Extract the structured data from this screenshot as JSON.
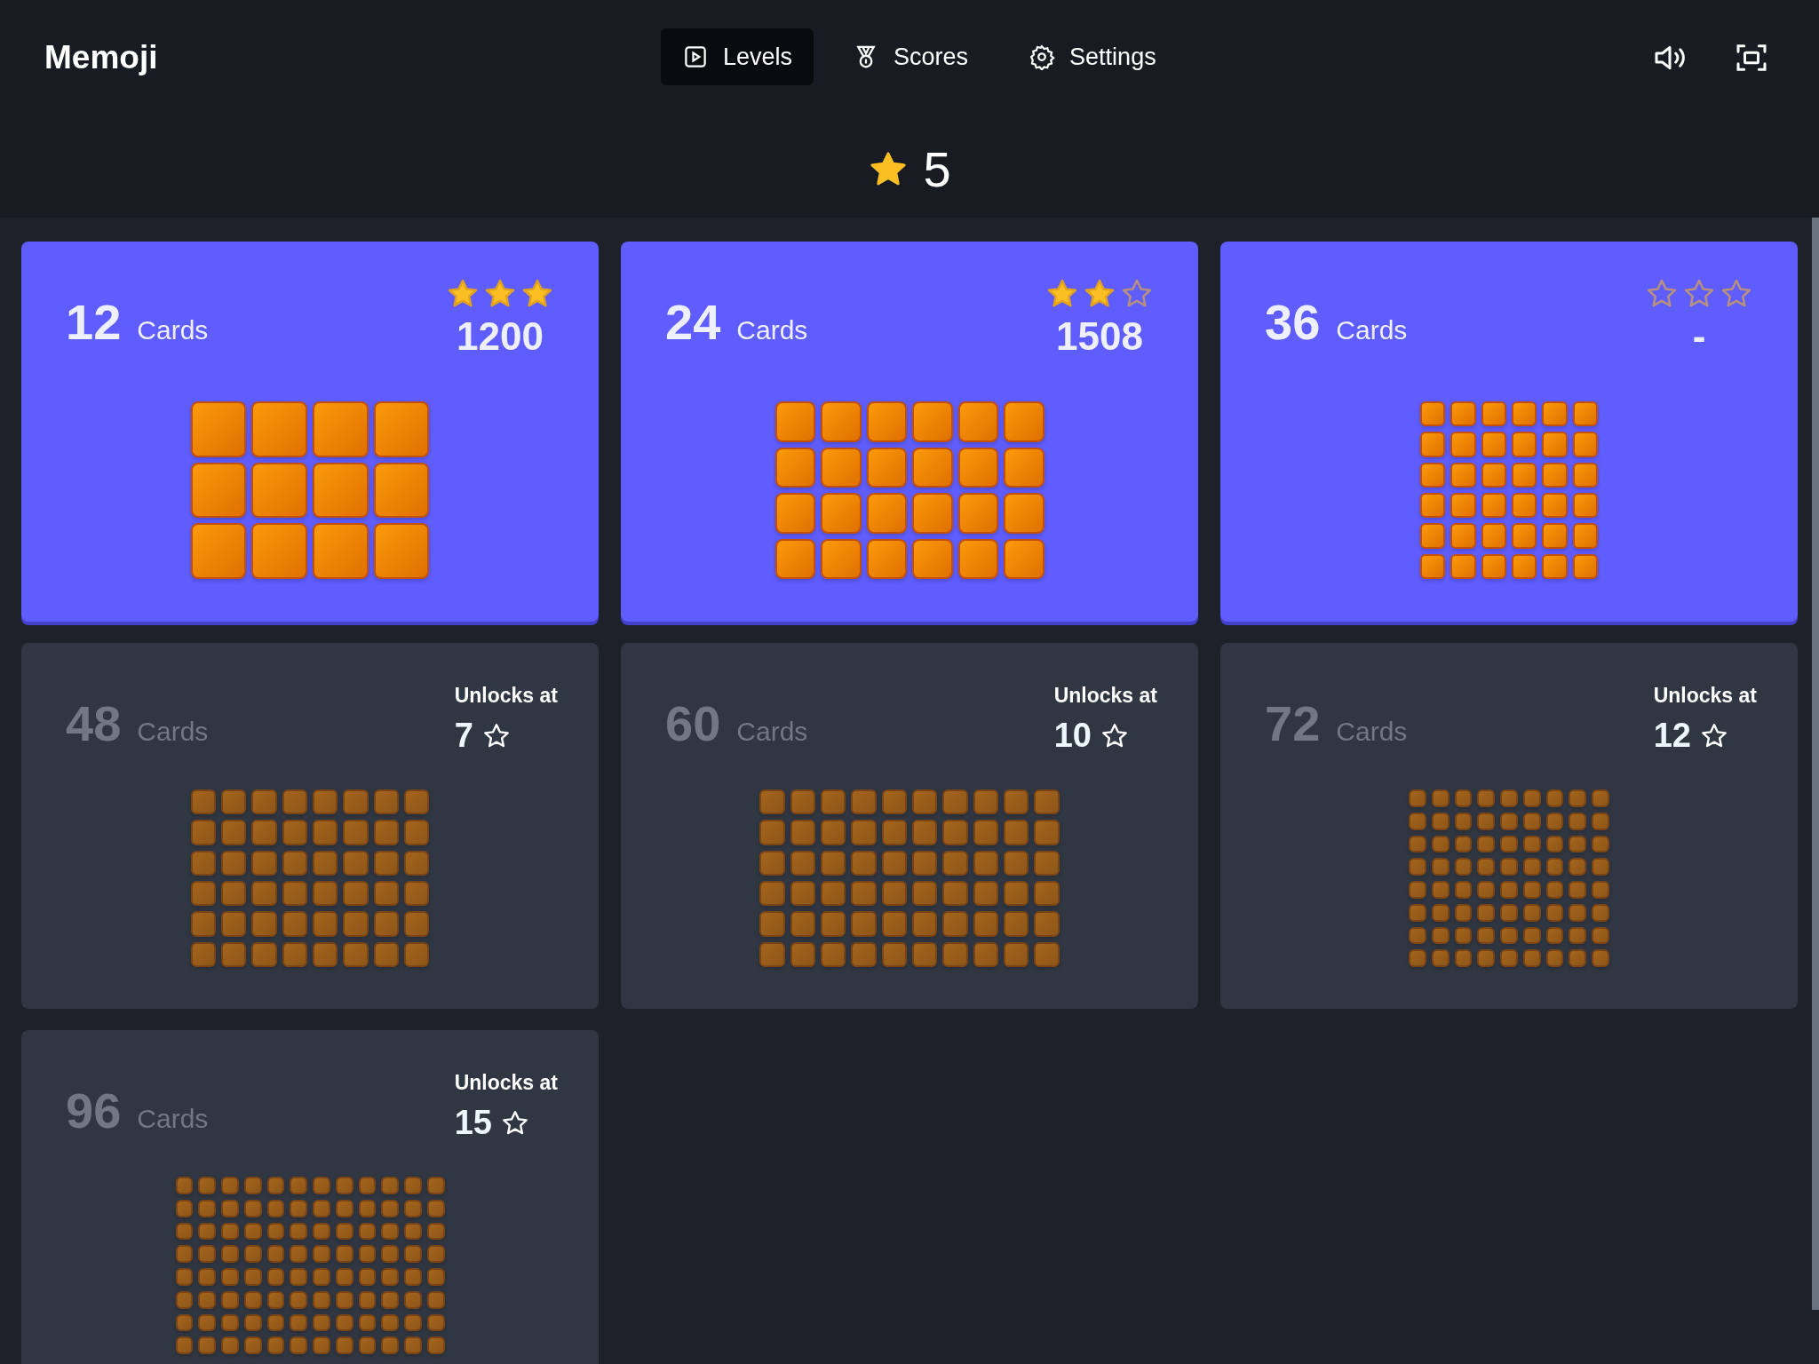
{
  "app_title": "Memoji",
  "nav": [
    {
      "label": "Levels",
      "kind": "play",
      "selected": true
    },
    {
      "label": "Scores",
      "kind": "medal",
      "selected": false
    },
    {
      "label": "Settings",
      "kind": "gear",
      "selected": false
    }
  ],
  "total_stars": "5",
  "levels": [
    {
      "count": "12",
      "unit": "Cards",
      "locked": false,
      "stars": 3,
      "score": "1200"
    },
    {
      "count": "24",
      "unit": "Cards",
      "locked": false,
      "stars": 2,
      "score": "1508"
    },
    {
      "count": "36",
      "unit": "Cards",
      "locked": false,
      "stars": 0,
      "score": "-"
    },
    {
      "count": "48",
      "unit": "Cards",
      "locked": true,
      "unlock_label": "Unlocks at",
      "unlock_stars": "7"
    },
    {
      "count": "60",
      "unit": "Cards",
      "locked": true,
      "unlock_label": "Unlocks at",
      "unlock_stars": "10"
    },
    {
      "count": "72",
      "unit": "Cards",
      "locked": true,
      "unlock_label": "Unlocks at",
      "unlock_stars": "12"
    },
    {
      "count": "96",
      "unit": "Cards",
      "locked": true,
      "unlock_label": "Unlocks at",
      "unlock_stars": "15"
    }
  ]
}
